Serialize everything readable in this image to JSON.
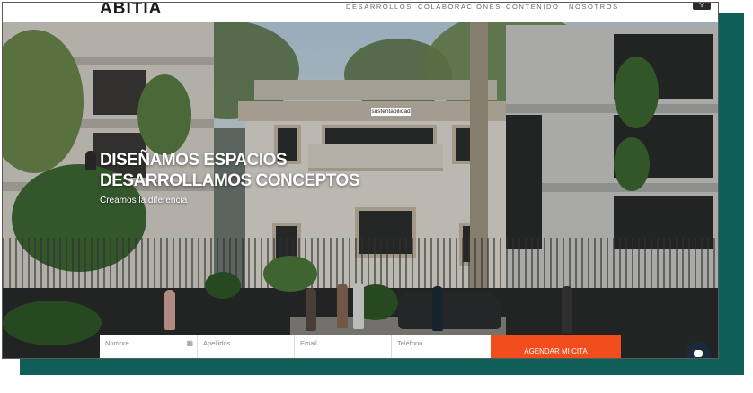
{
  "header": {
    "logo": "ABITIA",
    "nav": [
      "DESARROLLOS",
      "COLABORACIONES",
      "CONTENIDO",
      "NOSOTROS"
    ]
  },
  "badge": "sustentabilidad",
  "hero": {
    "title_line1": "DISEÑAMOS ESPACIOS",
    "title_line2": "DESARROLLAMOS CONCEPTOS",
    "subtitle": "Creamos la diferencia"
  },
  "form": {
    "nombre": "Nombre",
    "apellidos": "Apellidos",
    "email": "Email",
    "telefono": "Teléfono",
    "submit": "AGENDAR MI CITA"
  },
  "colors": {
    "accent": "#f24d1d",
    "frame_shadow": "#0f5f58"
  },
  "icons": [
    "search-icon",
    "contact-card-icon",
    "chat-icon"
  ]
}
